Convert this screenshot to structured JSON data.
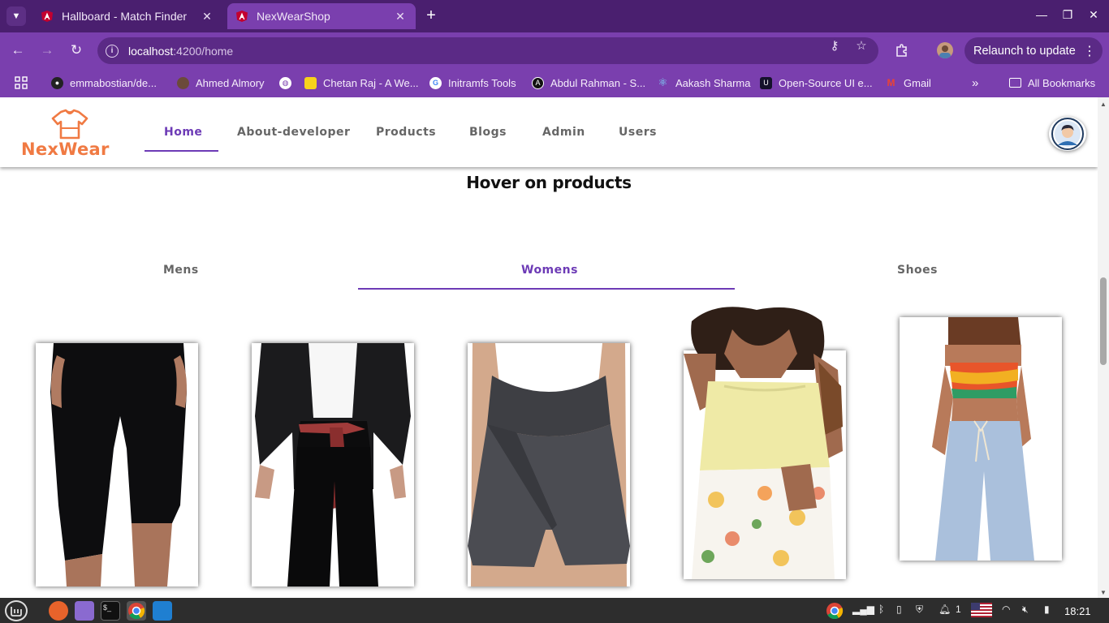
{
  "browser": {
    "tabs": [
      {
        "title": "Hallboard - Match Finder",
        "active": false
      },
      {
        "title": "NexWearShop",
        "active": true
      }
    ],
    "url_host": "localhost",
    "url_path": ":4200/home",
    "relaunch_label": "Relaunch to update",
    "bookmarks": [
      "emmabostian/de...",
      "Ahmed Almory",
      "Chetan Raj - A We...",
      "Initramfs Tools",
      "Abdul Rahman - S...",
      "Aakash Sharma",
      "Open-Source UI e...",
      "Gmail"
    ],
    "all_bookmarks_label": "All Bookmarks"
  },
  "site": {
    "logo_text": "NexWear",
    "nav": [
      "Home",
      "About-developer",
      "Products",
      "Blogs",
      "Admin",
      "Users"
    ],
    "active_nav": "Home",
    "section_title": "Hover on products",
    "categories": [
      "Mens",
      "Womens",
      "Shoes"
    ],
    "active_category": "Womens",
    "products": [
      {
        "name": "black-capri-leggings"
      },
      {
        "name": "black-leather-jacket-outfit"
      },
      {
        "name": "grey-crossover-shorts"
      },
      {
        "name": "yellow-tube-top-floral-skirt"
      },
      {
        "name": "tie-dye-tube-top-linen-pants"
      }
    ]
  },
  "taskbar": {
    "time": "18:21",
    "notification_count": "1"
  },
  "colors": {
    "accent": "#6d3bb6",
    "browser_frame": "#7a3fae",
    "tab_strip": "#4a1f6f",
    "logo": "#f07a43"
  }
}
